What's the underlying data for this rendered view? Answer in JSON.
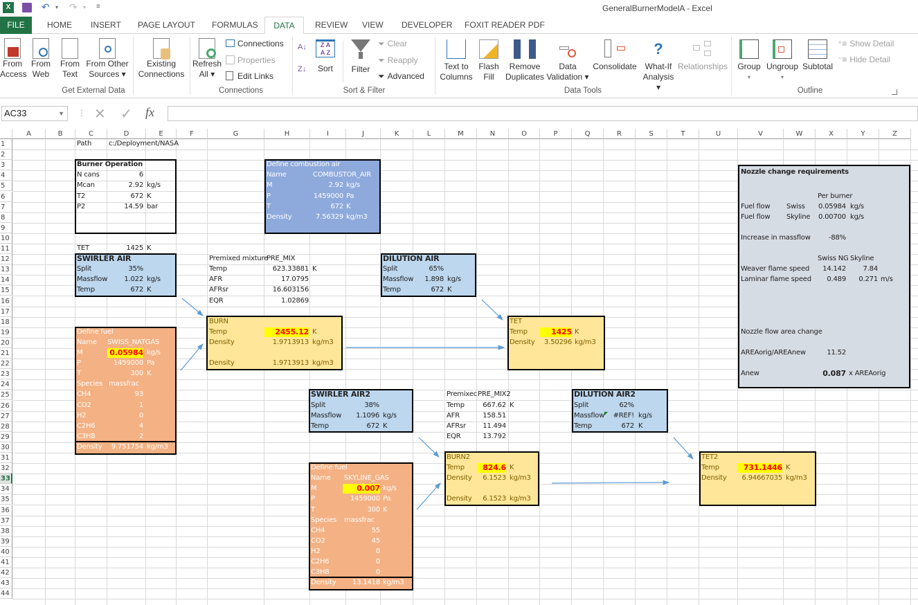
{
  "window": {
    "title": "GeneralBurnerModelA - Excel"
  },
  "quick_access": {
    "save": "save-icon",
    "undo": "undo-icon",
    "redo": "redo-icon",
    "customize": "customize-icon"
  },
  "tabs": [
    "FILE",
    "HOME",
    "INSERT",
    "PAGE LAYOUT",
    "FORMULAS",
    "DATA",
    "REVIEW",
    "VIEW",
    "DEVELOPER",
    "FOXIT READER PDF"
  ],
  "active_tab": "DATA",
  "ribbon": {
    "get_external": {
      "label": "Get External Data",
      "from_access": "From\nAccess",
      "from_access_1": "From",
      "from_access_2": "Access",
      "from_web_1": "From",
      "from_web_2": "Web",
      "from_text_1": "From",
      "from_text_2": "Text",
      "from_other_1": "From Other",
      "from_other_2": "Sources ▾",
      "existing_1": "Existing",
      "existing_2": "Connections"
    },
    "connections": {
      "label": "Connections",
      "refresh_1": "Refresh",
      "refresh_2": "All ▾",
      "connections": "Connections",
      "properties": "Properties",
      "edit_links": "Edit Links"
    },
    "sort_filter": {
      "label": "Sort & Filter",
      "sort": "Sort",
      "filter": "Filter",
      "clear": "Clear",
      "reapply": "Reapply",
      "advanced": "Advanced"
    },
    "data_tools": {
      "label": "Data Tools",
      "text_to_1": "Text to",
      "text_to_2": "Columns",
      "flash_1": "Flash",
      "flash_2": "Fill",
      "remove_1": "Remove",
      "remove_2": "Duplicates",
      "valid_1": "Data",
      "valid_2": "Validation ▾",
      "consolidate": "Consolidate",
      "whatif_1": "What-If",
      "whatif_2": "Analysis ▾",
      "relationships": "Relationships"
    },
    "outline": {
      "label": "Outline",
      "group": "Group",
      "ungroup": "Ungroup",
      "subtotal": "Subtotal",
      "show_detail": "Show Detail",
      "hide_detail": "Hide Detail"
    }
  },
  "formula_bar": {
    "name_box": "AC33",
    "formula": ""
  },
  "columns": [
    "A",
    "B",
    "C",
    "D",
    "E",
    "F",
    "G",
    "H",
    "I",
    "J",
    "K",
    "L",
    "M",
    "N",
    "O",
    "P",
    "Q",
    "R",
    "S",
    "T",
    "U",
    "V",
    "W",
    "X",
    "Y",
    "Z"
  ],
  "rows": [
    "1",
    "2",
    "3",
    "4",
    "5",
    "6",
    "7",
    "8",
    "9",
    "10",
    "11",
    "12",
    "13",
    "14",
    "15",
    "16",
    "17",
    "18",
    "19",
    "20",
    "21",
    "22",
    "23",
    "24",
    "25",
    "26",
    "27",
    "28",
    "29",
    "30",
    "31",
    "32",
    "33",
    "34",
    "35",
    "36",
    "37",
    "38",
    "39",
    "40",
    "41",
    "42",
    "43",
    "44"
  ],
  "sheet": {
    "path": {
      "label": "Path",
      "value": "c:/Deployment/NASA"
    },
    "burner_op": {
      "title": "Burner Operation",
      "rows": [
        [
          "N cans",
          "6",
          ""
        ],
        [
          "Mcan",
          "2.92",
          "kg/s"
        ],
        [
          "T2",
          "672",
          "K"
        ],
        [
          "P2",
          "14.59",
          "bar"
        ]
      ]
    },
    "tet_row": {
      "label": "TET",
      "value": "1425",
      "unit": "K"
    },
    "comb_air": {
      "title": "Define combustion air",
      "rows": [
        [
          "Name",
          "COMBUSTOR_AIR",
          ""
        ],
        [
          "M",
          "2.92",
          "kg/s"
        ],
        [
          "P",
          "1459000",
          "Pa"
        ],
        [
          "T",
          "672",
          "K"
        ],
        [
          "Density",
          "7.56329",
          "kg/m3"
        ]
      ]
    },
    "swirler": {
      "title": "SWIRLER AIR",
      "rows": [
        [
          "Split",
          "35%",
          ""
        ],
        [
          "Massflow",
          "1.022",
          "kg/s"
        ],
        [
          "Temp",
          "672",
          "K"
        ]
      ]
    },
    "premix": {
      "label": "Premixed mixture",
      "name": "PRE_MIX",
      "rows": [
        [
          "Temp",
          "623.33881",
          "K"
        ],
        [
          "AFR",
          "17.0795",
          ""
        ],
        [
          "AFRsr",
          "16.603156",
          ""
        ],
        [
          "EQR",
          "1.02869",
          ""
        ]
      ]
    },
    "dilution": {
      "title": "DILUTION AIR",
      "rows": [
        [
          "Split",
          "65%",
          ""
        ],
        [
          "Massflow",
          "1.898",
          "kg/s"
        ],
        [
          "Temp",
          "672",
          "K"
        ]
      ]
    },
    "burn": {
      "title": "BURN",
      "temp_label": "Temp",
      "temp": "2455.12",
      "temp_unit": "K",
      "dens_label": "Density",
      "dens": "1.9713913",
      "dens_unit": "kg/m3",
      "dens2_label": "Density",
      "dens2": "1.9713913",
      "dens2_unit": "kg/m3"
    },
    "tet": {
      "title": "TET",
      "temp_label": "Temp",
      "temp": "1425",
      "temp_unit": "K",
      "dens_label": "Density",
      "dens": "3.50296",
      "dens_unit": "kg/m3"
    },
    "fuel1": {
      "title": "Define fuel",
      "name_label": "Name",
      "name": "SWISS_NATGAS",
      "m_label": "M",
      "m": "0.05984",
      "m_unit": "kg/s",
      "rows": [
        [
          "P",
          "1459000",
          "Pa"
        ],
        [
          "T",
          "300",
          "K"
        ],
        [
          "Species",
          "massfrac",
          ""
        ],
        [
          "CH4",
          "93",
          ""
        ],
        [
          "CO2",
          "1",
          ""
        ],
        [
          "H2",
          "0",
          ""
        ],
        [
          "C2H6",
          "4",
          ""
        ],
        [
          "C3H8",
          "2",
          ""
        ]
      ],
      "density_label": "Density",
      "density": "9.751754",
      "density_unit": "kg/m3"
    },
    "swirler2": {
      "title": "SWIRLER AIR2",
      "rows": [
        [
          "Split",
          "38%",
          ""
        ],
        [
          "Massflow",
          "1.1096",
          "kg/s"
        ],
        [
          "Temp",
          "672",
          "K"
        ]
      ]
    },
    "premix2": {
      "label": "Premixec",
      "name": "PRE_MIX2",
      "rows": [
        [
          "Temp",
          "667.62",
          "K"
        ],
        [
          "AFR",
          "158.51",
          ""
        ],
        [
          "AFRsr",
          "11.494",
          ""
        ],
        [
          "EQR",
          "13.792",
          ""
        ]
      ]
    },
    "dilution2": {
      "title": "DILUTION AIR2",
      "rows": [
        [
          "Split",
          "62%",
          ""
        ],
        [
          "Massflow",
          "#REF!",
          "kg/s"
        ],
        [
          "Temp",
          "672",
          "K"
        ]
      ]
    },
    "burn2": {
      "title": "BURN2",
      "temp_label": "Temp",
      "temp": "824.6",
      "temp_unit": "K",
      "dens_label": "Density",
      "dens": "6.1523",
      "dens_unit": "kg/m3",
      "dens2_label": "Density",
      "dens2": "6.1523",
      "dens2_unit": "kg/m3"
    },
    "tet2": {
      "title": "TET2",
      "temp_label": "Temp",
      "temp": "731.1446",
      "temp_unit": "K",
      "dens_label": "Density",
      "dens": "6.94667035",
      "dens_unit": "kg/m3"
    },
    "fuel2": {
      "title": "Define fuel",
      "name_label": "Name",
      "name": "SKYLINE_GAS",
      "m_label": "M",
      "m": "0.007",
      "m_unit": "kg/s",
      "rows": [
        [
          "P",
          "1459000",
          "Pa"
        ],
        [
          "T",
          "300",
          "K"
        ],
        [
          "Species",
          "massfrac",
          ""
        ],
        [
          "CH4",
          "55",
          ""
        ],
        [
          "CO2",
          "45",
          ""
        ],
        [
          "H2",
          "0",
          ""
        ],
        [
          "C2H6",
          "0",
          ""
        ],
        [
          "C3H8",
          "0",
          ""
        ]
      ],
      "density_label": "Density",
      "density": "13.1418",
      "density_unit": "kg/m3"
    },
    "nozzle": {
      "title": "Nozzle change requirements",
      "per_burner": "Per burner",
      "fuel_rows": [
        [
          "Fuel flow",
          "Swiss",
          "0.05984",
          "kg/s"
        ],
        [
          "Fuel flow",
          "Skyline",
          "0.00700",
          "kg/s"
        ]
      ],
      "increase_label": "Increase in massflow",
      "increase": "-88%",
      "col_swiss": "Swiss NG",
      "col_skyline": "Skyline",
      "flame_rows": [
        [
          "Weaver flame speed",
          "14.142",
          "7.84",
          ""
        ],
        [
          "Laminar flame speed",
          "0.489",
          "0.271",
          "m/s"
        ]
      ],
      "area_change": "Nozzle flow area change",
      "ratio_label": "AREAorig/AREAnew",
      "ratio": "11.52",
      "anew_label": "Anew",
      "anew": "0.087",
      "anew_unit": "x AREAorig"
    }
  }
}
